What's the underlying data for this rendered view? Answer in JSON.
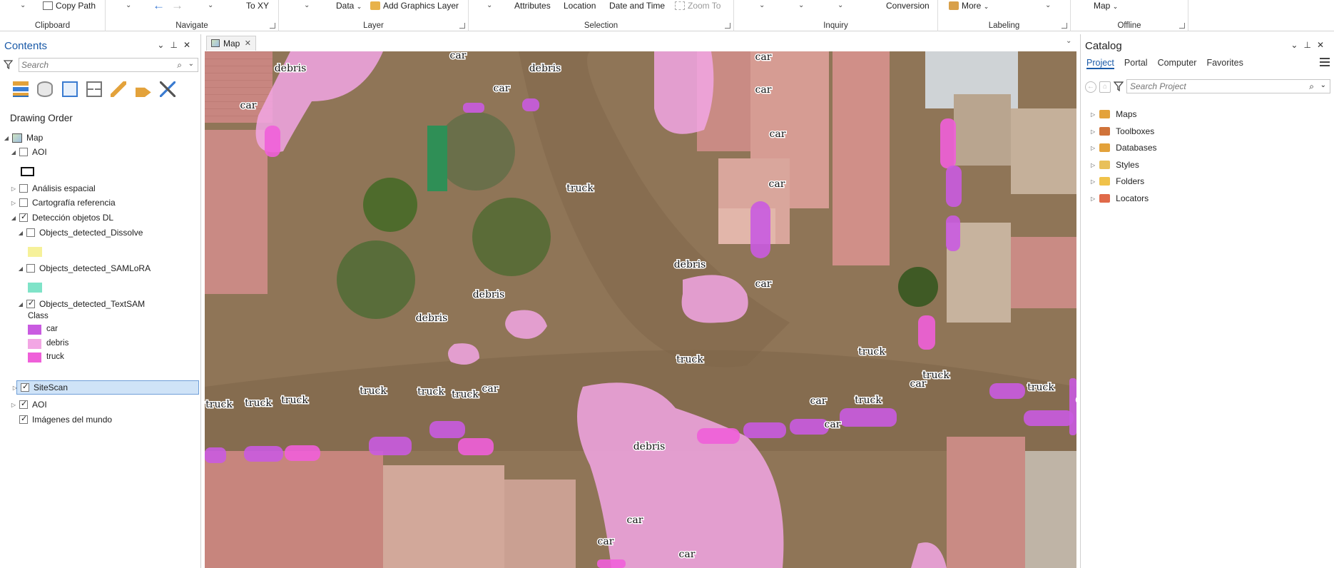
{
  "ribbon": {
    "clipboard": {
      "copy_path": "Copy Path",
      "title": "Clipboard"
    },
    "navigate": {
      "to_xy": "To XY",
      "title": "Navigate"
    },
    "layer": {
      "data": "Data",
      "add_graphics_layer": "Add Graphics Layer",
      "title": "Layer"
    },
    "selection": {
      "attributes": "Attributes",
      "location": "Location",
      "date_and_time": "Date and Time",
      "zoom_to": "Zoom To",
      "title": "Selection"
    },
    "inquiry": {
      "conversion": "Conversion",
      "title": "Inquiry"
    },
    "labeling": {
      "more": "More",
      "title": "Labeling"
    },
    "offline": {
      "map": "Map",
      "title": "Offline"
    }
  },
  "contents": {
    "title": "Contents",
    "search_placeholder": "Search",
    "section_title": "Drawing Order",
    "layers": {
      "map": "Map",
      "aoi_top": "AOI",
      "analisis": "Análisis espacial",
      "cartografia": "Cartografía referencia",
      "deteccion": "Detección objetos DL",
      "dissolve": "Objects_detected_Dissolve",
      "samlora": "Objects_detected_SAMLoRA",
      "textsam": "Objects_detected_TextSAM",
      "class_heading": "Class",
      "class_car": "car",
      "class_debris": "debris",
      "class_truck": "truck",
      "sitescan": "SiteScan",
      "aoi_bottom": "AOI",
      "imagenes": "Imágenes del mundo"
    },
    "colors": {
      "dissolve": "#f6f19a",
      "samlora": "#7fe3c8",
      "car": "#c95be0",
      "debris": "#f2a6e4",
      "truck": "#ef5fd9"
    }
  },
  "map": {
    "tab_label": "Map",
    "labels": {
      "debris": "debris",
      "car": "car",
      "truck": "truck"
    }
  },
  "catalog": {
    "title": "Catalog",
    "tabs": [
      "Project",
      "Portal",
      "Computer",
      "Favorites"
    ],
    "search_placeholder": "Search Project",
    "items": [
      "Maps",
      "Toolboxes",
      "Databases",
      "Styles",
      "Folders",
      "Locators"
    ]
  }
}
